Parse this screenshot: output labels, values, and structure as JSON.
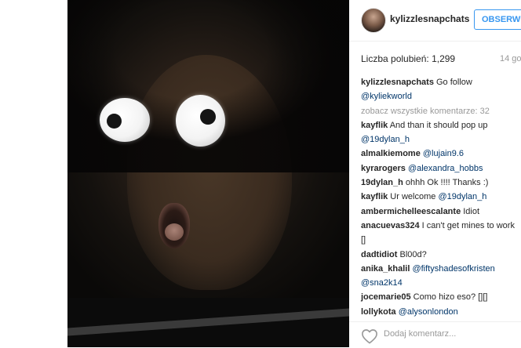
{
  "post": {
    "username": "kylizzlesnapchats",
    "follow_label": "OBSERWUJ",
    "likes_text": "Liczba polubień: 1,299",
    "date": "14 go",
    "caption": {
      "username": "kylizzlesnapchats",
      "text": " Go follow",
      "mention": "@kyliekworld"
    },
    "view_all_comments": "zobacz wszystkie komentarze: 32",
    "comments": [
      {
        "username": "kayflik",
        "text": " And than it should pop up",
        "mention": "@19dylan_h"
      },
      {
        "username": "almalkiemome",
        "text": " ",
        "mention": "@lujain9.6"
      },
      {
        "username": "kyrarogers",
        "text": " ",
        "mention": "@alexandra_hobbs"
      },
      {
        "username": "19dylan_h",
        "text": " ohhh Ok !!!! Thanks :)",
        "mention": "@kayflik"
      },
      {
        "username": "kayflik",
        "text": " Ur welcome ",
        "mention": "@19dylan_h"
      },
      {
        "username": "ambermichelleescalante",
        "text": " Idiot",
        "mention": ""
      },
      {
        "username": "anacuevas324",
        "text": " I can't get mines to work",
        "continuation": "[]"
      },
      {
        "username": "dadtidiot",
        "text": " Bl00d?",
        "mention": ""
      },
      {
        "username": "anika_khalil",
        "text": " ",
        "mention": "@fiftyshadesofkristen",
        "mention2": "@sna2k14"
      },
      {
        "username": "jocemarie05",
        "text": " Como hizo eso? [][]",
        "mention": ""
      },
      {
        "username": "lollykota",
        "text": " ",
        "mention": "@alysonlondon"
      }
    ],
    "add_comment_placeholder": "Dodaj komentarz..."
  },
  "icons": {
    "avatar": "user-avatar",
    "heart": "heart-icon"
  },
  "colors": {
    "accent": "#3897f0",
    "mention": "#003569",
    "muted": "#999999"
  }
}
